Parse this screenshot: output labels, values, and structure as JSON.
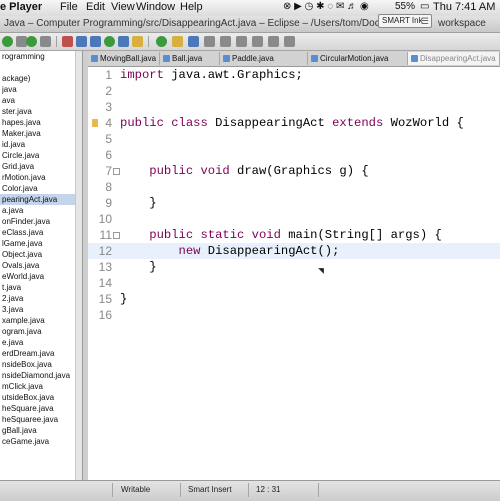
{
  "menubar": {
    "app_name": "e Player",
    "items": [
      "File",
      "Edit",
      "View",
      "Window",
      "Help"
    ],
    "battery": "55%",
    "clock": "Thu 7:41 AM"
  },
  "window": {
    "title": "Java – Computer Programming/src/DisappearingAct.java – Eclipse – /Users/tom/Docu",
    "title_tail": "workspace"
  },
  "smart_ink": {
    "label": "SMART Ink",
    "close": "☰"
  },
  "explorer": {
    "rows": [
      "rogramming",
      "",
      "ackage)",
      "java",
      "ava",
      "ster.java",
      "hapes.java",
      "Maker.java",
      "id.java",
      "Circle.java",
      "Grid.java",
      "rMotion.java",
      "Color.java",
      "pearingAct.java",
      "a.java",
      "onFinder.java",
      "eClass.java",
      "lGame.java",
      "Object.java",
      "Ovals.java",
      "eWorld.java",
      "t.java",
      "2.java",
      "3.java",
      "xample.java",
      "ogram.java",
      "e.java",
      "erdDream.java",
      "nsideBox.java",
      "nsideDiamond.java",
      "mClick.java",
      "utsideBox.java",
      "heSquare.java",
      "heSquaree.java",
      "gBall.java",
      "ceGame.java"
    ],
    "selected_index": 13
  },
  "tabs": [
    {
      "label": "MovingBall.java"
    },
    {
      "label": "Ball.java"
    },
    {
      "label": "Paddle.java"
    },
    {
      "label": "CircularMotion.java"
    },
    {
      "label": "DisappearingAct.java"
    }
  ],
  "editor": {
    "lines": [
      {
        "n": "1",
        "kw": "import",
        "rest": " java.awt.Graphics;"
      },
      {
        "n": "2",
        "kw": "",
        "rest": ""
      },
      {
        "n": "3",
        "kw": "",
        "rest": ""
      },
      {
        "n": "4",
        "kw": "public class",
        "rest": " DisappearingAct ",
        "kw2": "extends",
        "rest2": " WozWorld {"
      },
      {
        "n": "5",
        "kw": "",
        "rest": ""
      },
      {
        "n": "6",
        "kw": "",
        "rest": ""
      },
      {
        "n": "7",
        "kw": "    public void",
        "rest": " draw(Graphics g) {"
      },
      {
        "n": "8",
        "kw": "",
        "rest": ""
      },
      {
        "n": "9",
        "kw": "",
        "rest": "    }"
      },
      {
        "n": "10",
        "kw": "",
        "rest": ""
      },
      {
        "n": "11",
        "kw": "    public static void",
        "rest": " main(String[] args) {"
      },
      {
        "n": "12",
        "kw": "        new",
        "rest": " DisappearingAct();"
      },
      {
        "n": "13",
        "kw": "",
        "rest": "    }"
      },
      {
        "n": "14",
        "kw": "",
        "rest": ""
      },
      {
        "n": "15",
        "kw": "",
        "rest": "}"
      },
      {
        "n": "16",
        "kw": "",
        "rest": ""
      }
    ]
  },
  "statusbar": {
    "mode": "Writable",
    "insert": "Smart Insert",
    "position": "12 : 31"
  }
}
